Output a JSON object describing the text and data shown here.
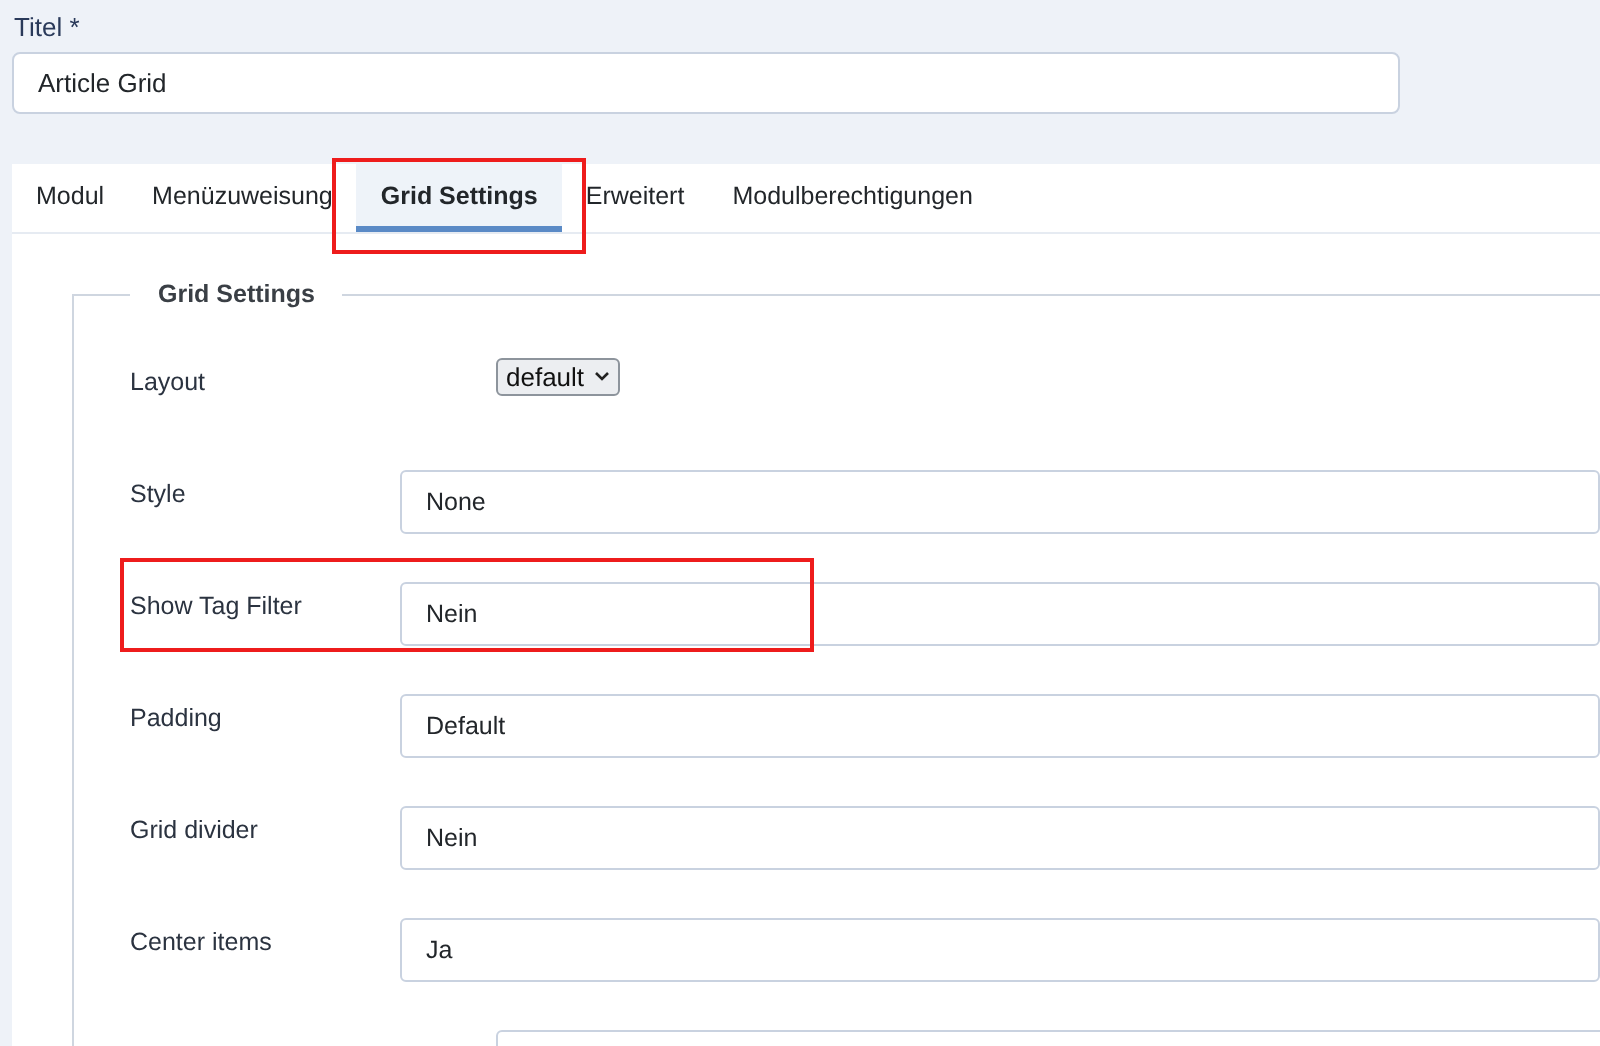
{
  "title_field": {
    "label": "Titel *",
    "value": "Article Grid"
  },
  "tabs": [
    {
      "label": "Modul",
      "selected": false,
      "highlighted": false
    },
    {
      "label": "Menüzuweisung",
      "selected": false,
      "highlighted": false
    },
    {
      "label": "Grid Settings",
      "selected": true,
      "highlighted": true
    },
    {
      "label": "Erweitert",
      "selected": false,
      "highlighted": false
    },
    {
      "label": "Modulberechtigungen",
      "selected": false,
      "highlighted": false
    }
  ],
  "fieldset": {
    "legend": "Grid Settings",
    "rows": [
      {
        "label": "Layout",
        "kind": "dropdown",
        "value": "default",
        "highlighted": false
      },
      {
        "label": "Style",
        "kind": "select",
        "value": "None",
        "highlighted": false
      },
      {
        "label": "Show Tag Filter",
        "kind": "select",
        "value": "Nein",
        "highlighted": true
      },
      {
        "label": "Padding",
        "kind": "select",
        "value": "Default",
        "highlighted": false
      },
      {
        "label": "Grid divider",
        "kind": "select",
        "value": "Nein",
        "highlighted": false
      },
      {
        "label": "Center items",
        "kind": "select",
        "value": "Ja",
        "highlighted": false
      }
    ]
  }
}
